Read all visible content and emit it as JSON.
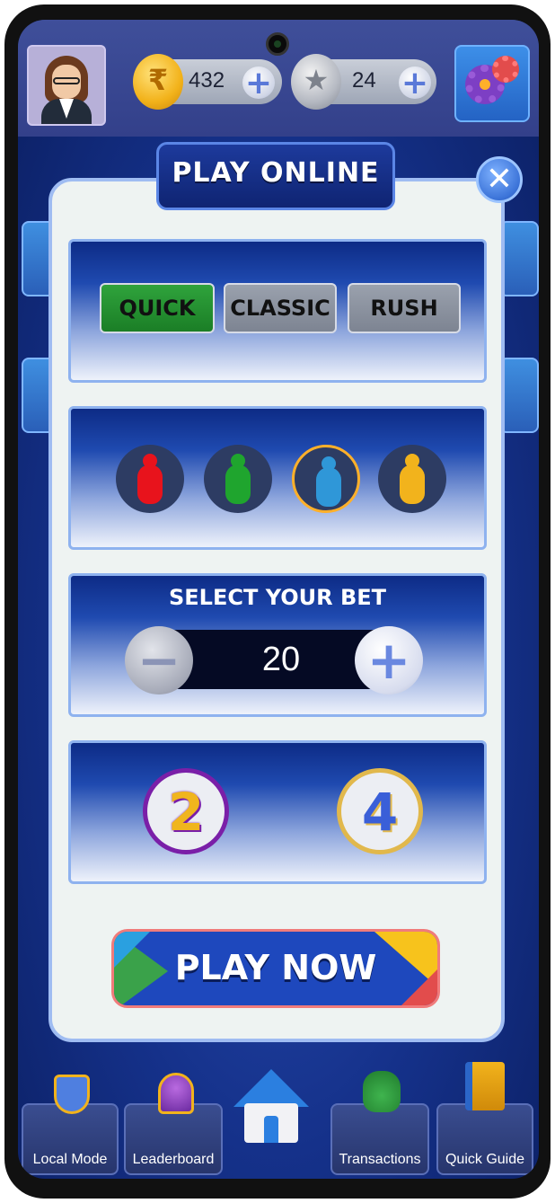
{
  "header": {
    "gold_balance": "432",
    "gold_symbol": "₹",
    "silver_balance": "24",
    "silver_symbol": "★",
    "plus_label": "+"
  },
  "dialog": {
    "title": "PLAY ONLINE",
    "close_label": "✕",
    "modes": [
      {
        "label": "QUICK",
        "selected": true
      },
      {
        "label": "CLASSIC",
        "selected": false
      },
      {
        "label": "RUSH",
        "selected": false
      }
    ],
    "tokens": [
      {
        "color": "#e8131c",
        "selected": false
      },
      {
        "color": "#1fa52e",
        "selected": false
      },
      {
        "color": "#2f97d8",
        "selected": true
      },
      {
        "color": "#f2b31c",
        "selected": false
      }
    ],
    "bet": {
      "label": "SELECT YOUR BET",
      "value": "20",
      "minus_label": "−",
      "plus_label": "+"
    },
    "players": [
      {
        "label": "2",
        "selected": true
      },
      {
        "label": "4",
        "selected": false
      }
    ],
    "play_label": "PLAY NOW"
  },
  "nav": {
    "items": [
      {
        "label": "Local Mode",
        "icon": "shield-vs-icon"
      },
      {
        "label": "Leaderboard",
        "icon": "trophy-icon"
      },
      {
        "label": "",
        "icon": "home-icon"
      },
      {
        "label": "Transactions",
        "icon": "money-bag-icon"
      },
      {
        "label": "Quick Guide",
        "icon": "book-icon"
      }
    ]
  },
  "colors": {
    "accent_blue": "#1e48bd",
    "quick_green": "#2fa33c",
    "panel_bg": "#eef3f2"
  }
}
